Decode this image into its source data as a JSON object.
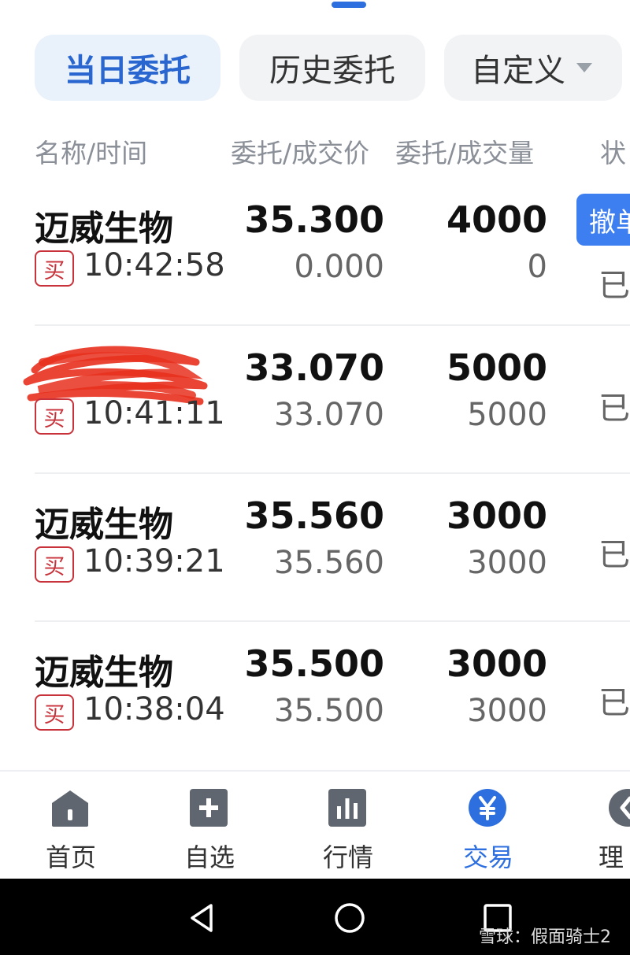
{
  "tabs": {
    "today": "当日委托",
    "history": "历史委托",
    "custom": "自定义"
  },
  "columns": {
    "name": "名称/时间",
    "price": "委托/成交价",
    "qty": "委托/成交量",
    "status": "状"
  },
  "rows": [
    {
      "name": "迈威生物",
      "side": "买",
      "time": "10:42:58",
      "order_price": "35.300",
      "fill_price": "0.000",
      "order_qty": "4000",
      "fill_qty": "0",
      "status": "已",
      "action": "撤单"
    },
    {
      "name": "",
      "side": "买",
      "time": "10:41:11",
      "order_price": "33.070",
      "fill_price": "33.070",
      "order_qty": "5000",
      "fill_qty": "5000",
      "status": "已"
    },
    {
      "name": "迈威生物",
      "side": "买",
      "time": "10:39:21",
      "order_price": "35.560",
      "fill_price": "35.560",
      "order_qty": "3000",
      "fill_qty": "3000",
      "status": "已"
    },
    {
      "name": "迈威生物",
      "side": "买",
      "time": "10:38:04",
      "order_price": "35.500",
      "fill_price": "35.500",
      "order_qty": "3000",
      "fill_qty": "3000",
      "status": "已"
    }
  ],
  "nav": {
    "home": {
      "label": "首页",
      "icon": "home-icon"
    },
    "watchlist": {
      "label": "自选",
      "icon": "plus-square-icon"
    },
    "market": {
      "label": "行情",
      "icon": "bar-chart-icon"
    },
    "trade": {
      "label": "交易",
      "icon": "yen-circle-icon"
    },
    "wealth": {
      "label": "理",
      "icon": "wealth-icon"
    }
  },
  "watermark": "雪球：假面骑士2",
  "colors": {
    "accent": "#2e6fe0",
    "buy": "#c8323a",
    "redact": "#e8301e"
  }
}
